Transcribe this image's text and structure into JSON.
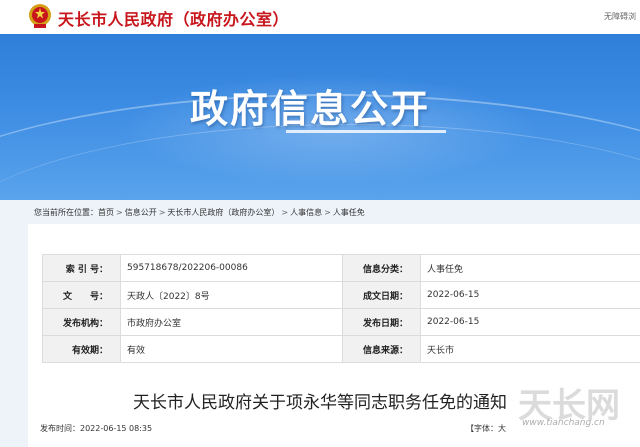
{
  "header": {
    "site_name": "天长市人民政府（政府办公室）",
    "barrier_free": "无障碍浏",
    "emblem_icon": "national-emblem-icon",
    "brand_color": "#c8161d"
  },
  "banner": {
    "title": "政府信息公开",
    "background_color": "#3b8be3"
  },
  "breadcrumb": {
    "prefix": "您当前所在位置：",
    "items": [
      "首页",
      "信息公开",
      "天长市人民政府（政府办公室）",
      "人事信息",
      "人事任免"
    ],
    "separator": ">"
  },
  "info": {
    "index_label": "索 引 号：",
    "index_value": "595718678/202206-00086",
    "category_label": "信息分类：",
    "category_value": "人事任免",
    "docno_label": "文　　号：",
    "docno_value": "天政人〔2022〕8号",
    "created_label": "成文日期：",
    "created_value": "2022-06-15",
    "org_label": "发布机构：",
    "org_value": "市政府办公室",
    "published_label": "发布日期：",
    "published_value": "2022-06-15",
    "validity_label": "有效期：",
    "validity_value": "有效",
    "source_label": "信息来源：",
    "source_value": "天长市"
  },
  "document": {
    "title": "天长市人民政府关于项永华等同志职务任免的通知",
    "publish_time_label": "发布时间：",
    "publish_time": "2022-06-15 08:35",
    "font_control": "【字体：大"
  },
  "watermark": {
    "text": "天长网",
    "url": "www.tianchang.cn"
  }
}
